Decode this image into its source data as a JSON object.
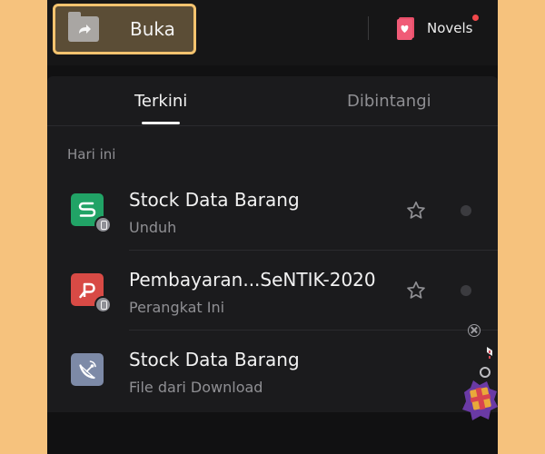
{
  "header": {
    "open_button_label": "Buka",
    "novels_label": "Novels",
    "accent_color": "#f4c36f",
    "notification_color": "#f1484b"
  },
  "tabs": [
    {
      "label": "Terkini",
      "active": true
    },
    {
      "label": "Dibintangi",
      "active": false
    }
  ],
  "section": {
    "label": "Hari ini"
  },
  "files": [
    {
      "title": "Stock Data Barang",
      "subtitle": "Unduh",
      "icon": "spreadsheet-icon",
      "color": "#21a366",
      "badge": "device-icon"
    },
    {
      "title": "Pembayaran...SeNTIK-2020",
      "subtitle": "Perangkat Ini",
      "icon": "presentation-icon",
      "color": "#d84a45",
      "badge": "device-icon"
    },
    {
      "title": "Stock Data Barang",
      "subtitle": "File dari Download",
      "icon": "satellite-dish-icon",
      "color": "#7d8aa7"
    }
  ]
}
